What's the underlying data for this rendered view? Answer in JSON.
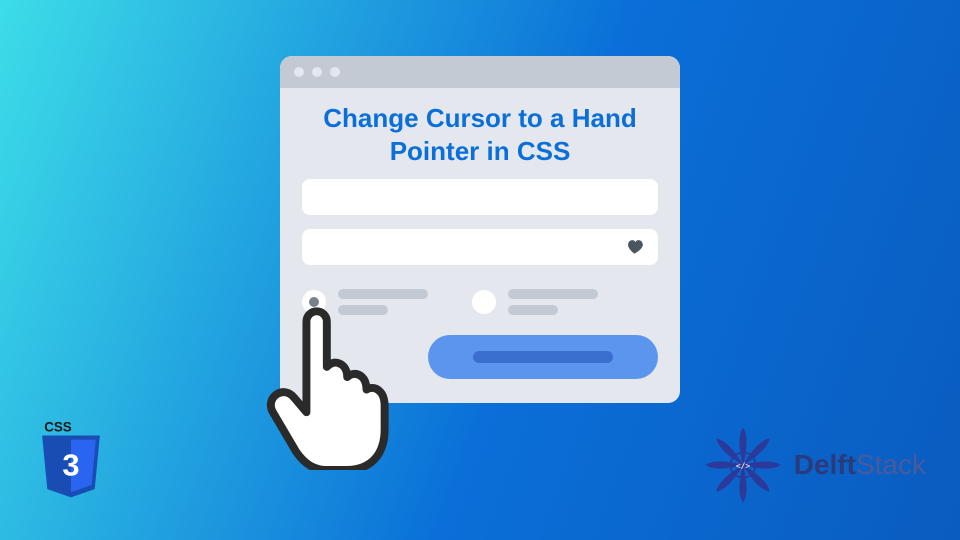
{
  "title": "Change Cursor to a Hand Pointer in CSS",
  "cssLogo": {
    "label": "CSS",
    "version": "3"
  },
  "brand": {
    "name1": "Delft",
    "name2": "Stack"
  },
  "icons": {
    "heart": "heart-icon",
    "hand": "hand-pointer-icon",
    "mandala": "mandala-icon"
  }
}
